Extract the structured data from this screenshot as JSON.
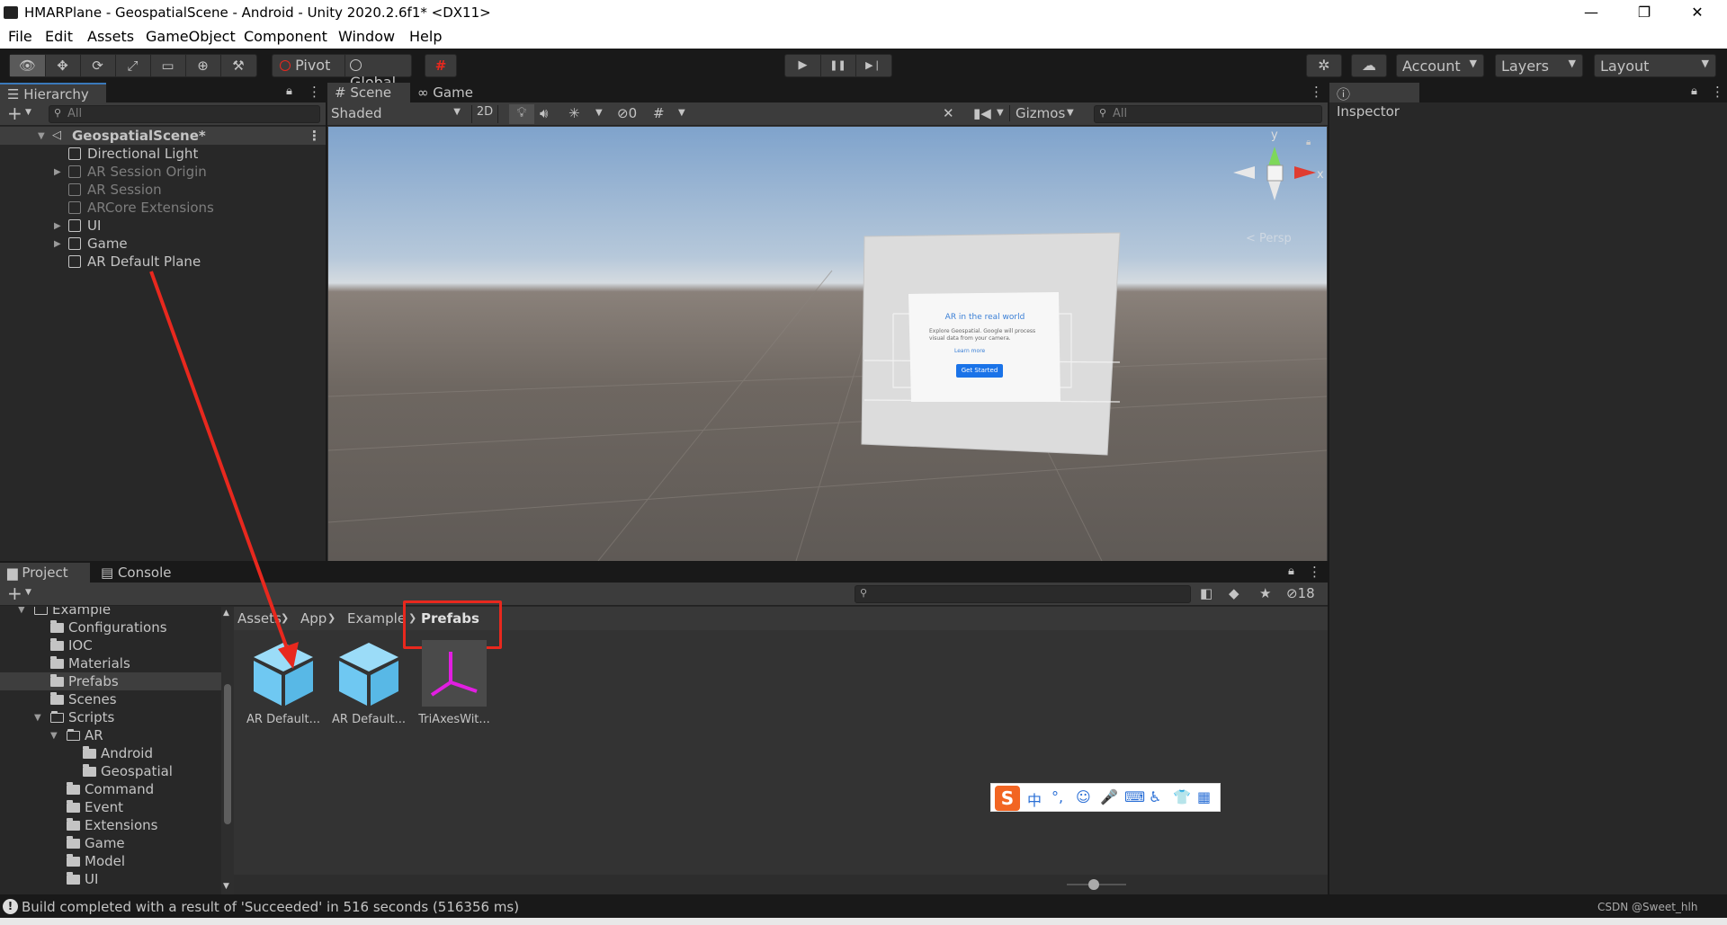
{
  "window": {
    "title": "HMARPlane - GeospatialScene - Android - Unity 2020.2.6f1* <DX11>",
    "minimize": "—",
    "restore": "❐",
    "close": "✕"
  },
  "menu": [
    "File",
    "Edit",
    "Assets",
    "GameObject",
    "Component",
    "Window",
    "Help"
  ],
  "toolbar": {
    "tools": [
      "👁",
      "✥",
      "⟳",
      "⤢",
      "▭",
      "⊕",
      "⚒"
    ],
    "pivot": "Pivot",
    "global": "Global",
    "grid": "#",
    "play": "▶",
    "pause": "❚❚",
    "step": "▶❘",
    "collab": "✲",
    "cloud": "☁",
    "account": "Account",
    "layers": "Layers",
    "layout": "Layout"
  },
  "hierarchy": {
    "tab": "Hierarchy",
    "add": "+",
    "search_placeholder": "All",
    "scene": "GeospatialScene*",
    "items": [
      {
        "label": "Directional Light",
        "dim": false,
        "expand": false
      },
      {
        "label": "AR Session Origin",
        "dim": true,
        "expand": true
      },
      {
        "label": "AR Session",
        "dim": true,
        "expand": false
      },
      {
        "label": "ARCore Extensions",
        "dim": true,
        "expand": false
      },
      {
        "label": "UI",
        "dim": false,
        "expand": true
      },
      {
        "label": "Game",
        "dim": false,
        "expand": true
      },
      {
        "label": "AR Default Plane",
        "dim": false,
        "expand": false
      }
    ]
  },
  "scene_view": {
    "tab_scene": "Scene",
    "tab_game": "Game",
    "shading": "Shaded",
    "mode_2d": "2D",
    "hidden_count": "0",
    "gizmos": "Gizmos",
    "search_placeholder": "All",
    "gizmo_y": "y",
    "gizmo_x": "x",
    "persp": "< Persp",
    "card": {
      "title": "AR in the real world",
      "body": "Explore Geospatial. Google will process visual data from your camera.",
      "link": "Learn more",
      "button": "Get Started"
    }
  },
  "inspector": {
    "tab": "Inspector"
  },
  "project": {
    "tab_project": "Project",
    "tab_console": "Console",
    "add": "+",
    "count": "18",
    "breadcrumb": [
      "Assets",
      "App",
      "Example",
      "Prefabs"
    ],
    "tree": [
      {
        "label": "Example",
        "indent": 1,
        "arrow": "▼",
        "open": true
      },
      {
        "label": "Configurations",
        "indent": 2,
        "arrow": "",
        "open": false
      },
      {
        "label": "IOC",
        "indent": 2,
        "arrow": "",
        "open": false
      },
      {
        "label": "Materials",
        "indent": 2,
        "arrow": "",
        "open": false
      },
      {
        "label": "Prefabs",
        "indent": 2,
        "arrow": "",
        "open": false,
        "selected": true
      },
      {
        "label": "Scenes",
        "indent": 2,
        "arrow": "",
        "open": false
      },
      {
        "label": "Scripts",
        "indent": 2,
        "arrow": "▼",
        "open": true
      },
      {
        "label": "AR",
        "indent": 3,
        "arrow": "▼",
        "open": true
      },
      {
        "label": "Android",
        "indent": 4,
        "arrow": "",
        "open": false
      },
      {
        "label": "Geospatial",
        "indent": 4,
        "arrow": "",
        "open": false
      },
      {
        "label": "Command",
        "indent": 3,
        "arrow": "",
        "open": false
      },
      {
        "label": "Event",
        "indent": 3,
        "arrow": "",
        "open": false
      },
      {
        "label": "Extensions",
        "indent": 3,
        "arrow": "",
        "open": false
      },
      {
        "label": "Game",
        "indent": 3,
        "arrow": "",
        "open": false
      },
      {
        "label": "Model",
        "indent": 3,
        "arrow": "",
        "open": false
      },
      {
        "label": "UI",
        "indent": 3,
        "arrow": "",
        "open": false
      }
    ],
    "assets": [
      {
        "label": "AR Default...",
        "kind": "cube"
      },
      {
        "label": "AR Default...",
        "kind": "cube"
      },
      {
        "label": "TriAxesWit...",
        "kind": "axes"
      }
    ]
  },
  "ime": {
    "logo": "S",
    "items": [
      "中",
      "°,",
      "☺",
      "🎤",
      "⌨",
      "♿",
      "👕",
      "▦"
    ]
  },
  "status": {
    "icon": "!",
    "message": "Build completed with a result of 'Succeeded' in 516 seconds (516356 ms)",
    "watermark": "CSDN @Sweet_hlh"
  },
  "colors": {
    "accent_red": "#e8281e",
    "asset_blue": "#6fc8f2",
    "magenta": "#e21ee2",
    "ime_orange": "#f26522"
  }
}
